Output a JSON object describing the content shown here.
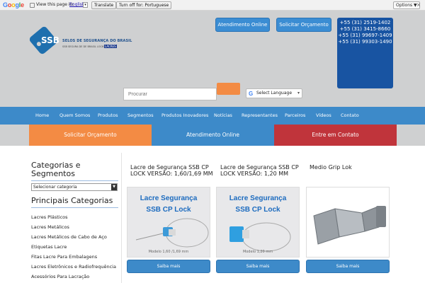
{
  "translate_bar": {
    "logo": "Google",
    "message": "View this page in:",
    "language_link": "English",
    "translate_button": "Translate",
    "turn_off_button": "Turn off for: Portuguese",
    "options_button": "Options ▼",
    "close": "×"
  },
  "header": {
    "logo_mark": "SSB",
    "logo_title": "SELOS DE SEGURANÇA DO BRASIL",
    "logo_subtitle": "SSB SEGURA DE DE BRASIL LOCKS",
    "logo_badge": "LACRES",
    "online_button": "Atendimento Online",
    "quote_button": "Solicitar Orçamento",
    "phones": [
      "+55 (31) 2519-1402",
      "+55 (31) 3415-8660",
      "+55 (31) 99697-1409",
      "+55 (31) 99303-1490"
    ],
    "search_placeholder": "Procurar",
    "language_select": "Select Language"
  },
  "nav": {
    "items": [
      "Home",
      "Quem Somos",
      "Produtos",
      "Segmentos",
      "Produtos Inovadores",
      "Notícias",
      "Representantes",
      "Parceiros",
      "Vídeos",
      "Contato"
    ]
  },
  "tiles": {
    "quote": "Solicitar Orçamento",
    "online": "Atendimento Online",
    "contact": "Entre em Contato"
  },
  "colors": {
    "orange": "#f38b44",
    "blue": "#3d8ac9",
    "red": "#c0343b",
    "dark_blue": "#1854a2"
  },
  "sidebar": {
    "categories_heading": "Categorias e Segmentos",
    "category_select": "Selecionar categoria",
    "main_heading": "Principais Categorias",
    "items": [
      "Lacres Plásticos",
      "Lacres Metálicos",
      "Lacres Metálicos de Cabo de Aço",
      "Etiquetas Lacre",
      "Fitas Lacre Para Embalagens",
      "Lacres Eletrônicos e Radiofrequência",
      "Acessórios Para Lacração"
    ]
  },
  "products": [
    {
      "title": "Lacre de Segurança SSB CP LOCK VERSÃO: 1,60/1,69 MM",
      "image_line1": "Lacre Segurança",
      "image_line2": "SSB CP Lock",
      "image_caption": "Modelo 1,60 /1,69 mm",
      "button": "Saiba mais"
    },
    {
      "title": "Lacre de Segurança SSB CP LOCK VERSÃO: 1,20 MM",
      "image_line1": "Lacre Segurança",
      "image_line2": "SSB CP Lock",
      "image_caption": "Modelo 1,20 mm",
      "button": "Saiba mais"
    },
    {
      "title": "Medio Grip Lok",
      "button": "Saiba mais"
    }
  ]
}
